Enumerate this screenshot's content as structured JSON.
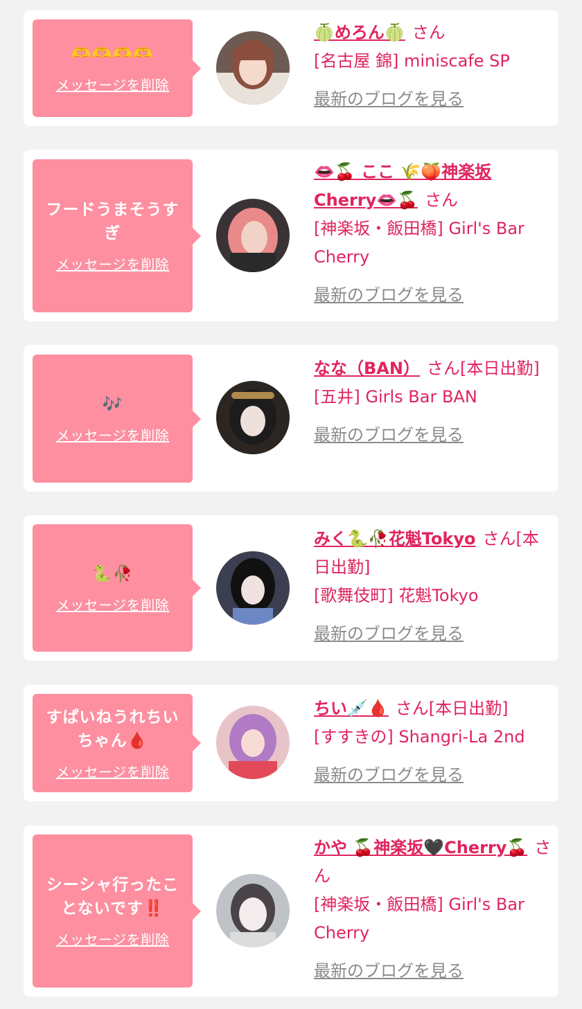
{
  "items": [
    {
      "message": "🫶🫶🫶🫶",
      "delete_label": "メッセージを削除",
      "name": "🍈めろん🍈",
      "honorific": "さん",
      "status": "",
      "shop": "[名古屋 錦] miniscafe SP",
      "blog_label": "最新のブログを見る"
    },
    {
      "message": "フードうまそうすぎ",
      "delete_label": "メッセージを削除",
      "name": "👄🍒 ここ 🌾🍑神楽坂Cherry👄🍒",
      "honorific": "さん",
      "status": "",
      "shop": "[神楽坂・飯田橋] Girl's Bar Cherry",
      "blog_label": "最新のブログを見る"
    },
    {
      "message": "🎶",
      "delete_label": "メッセージを削除",
      "name": "なな（BAN）",
      "honorific": "さん",
      "status": "[本日出勤]",
      "shop": "[五井] Girls Bar BAN",
      "blog_label": "最新のブログを見る"
    },
    {
      "message": "🐍🥀",
      "delete_label": "メッセージを削除",
      "name": "みく🐍🥀花魁Tokyo",
      "honorific": "さん",
      "status": "[本日出勤]",
      "shop": "[歌舞伎町] 花魁Tokyo",
      "blog_label": "最新のブログを見る"
    },
    {
      "message": "すぱいねうれちいちゃん🩸",
      "delete_label": "メッセージを削除",
      "name": "ちい💉🩸",
      "honorific": "さん",
      "status": "[本日出勤]",
      "shop": "[すすきの] Shangri-La 2nd",
      "blog_label": "最新のブログを見る"
    },
    {
      "message": "シーシャ行ったことないです‼️",
      "delete_label": "メッセージを削除",
      "name": "かや 🍒神楽坂🖤Cherry🍒",
      "honorific": "さん",
      "status": "",
      "shop": "[神楽坂・飯田橋] Girl's Bar Cherry",
      "blog_label": "最新のブログを見る"
    }
  ],
  "colors": {
    "page_bg": "#f2f2f2",
    "card_bg": "#ffffff",
    "bubble_bg": "#fd8fa0",
    "accent": "#e0245e",
    "link_gray": "#8a8a8a"
  }
}
